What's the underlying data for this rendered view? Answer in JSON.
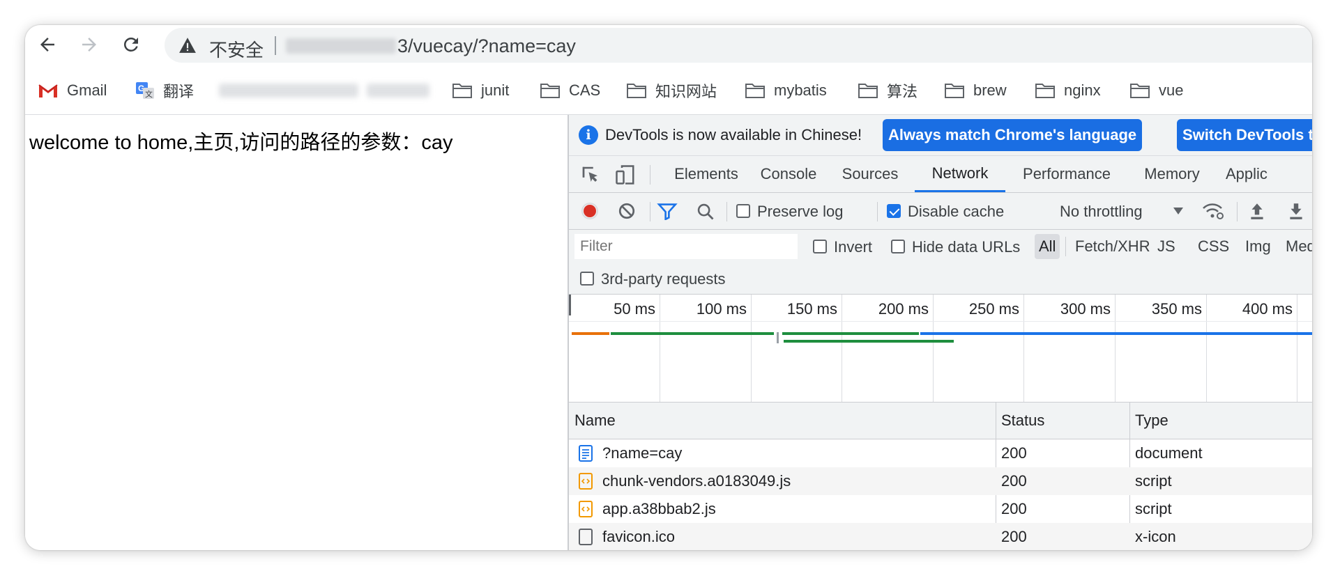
{
  "browser": {
    "security_label": "不安全",
    "url_suffix": "3/vuecay/?name=cay"
  },
  "bookmarks": [
    {
      "label": "Gmail",
      "icon": "gmail-icon"
    },
    {
      "label": "翻译",
      "icon": "translate-icon"
    },
    {
      "label": "junit",
      "icon": "folder-icon"
    },
    {
      "label": "CAS",
      "icon": "folder-icon"
    },
    {
      "label": "知识网站",
      "icon": "folder-icon"
    },
    {
      "label": "mybatis",
      "icon": "folder-icon"
    },
    {
      "label": "算法",
      "icon": "folder-icon"
    },
    {
      "label": "brew",
      "icon": "folder-icon"
    },
    {
      "label": "nginx",
      "icon": "folder-icon"
    },
    {
      "label": "vue",
      "icon": "folder-icon"
    }
  ],
  "page": {
    "text": "welcome to home,主页,访问的路径的参数：cay"
  },
  "devtools": {
    "infobar": {
      "message": "DevTools is now available in Chinese!",
      "button_match": "Always match Chrome's language",
      "button_switch": "Switch DevTools to C"
    },
    "tabs": [
      "Elements",
      "Console",
      "Sources",
      "Network",
      "Performance",
      "Memory",
      "Applic"
    ],
    "active_tab": "Network",
    "network_toolbar": {
      "preserve_log": "Preserve log",
      "disable_cache": "Disable cache",
      "throttling": "No throttling"
    },
    "filter": {
      "placeholder": "Filter",
      "invert": "Invert",
      "hide_data_urls": "Hide data URLs",
      "types": [
        "All",
        "Fetch/XHR",
        "JS",
        "CSS",
        "Img",
        "Med"
      ],
      "third_party": "3rd-party requests"
    },
    "timeline_ticks": [
      "50 ms",
      "100 ms",
      "150 ms",
      "200 ms",
      "250 ms",
      "300 ms",
      "350 ms",
      "400 ms"
    ],
    "table": {
      "headers": {
        "name": "Name",
        "status": "Status",
        "type": "Type"
      },
      "rows": [
        {
          "name": "?name=cay",
          "status": "200",
          "type": "document",
          "icon": "document-icon"
        },
        {
          "name": "chunk-vendors.a0183049.js",
          "status": "200",
          "type": "script",
          "icon": "script-file-icon"
        },
        {
          "name": "app.a38bbab2.js",
          "status": "200",
          "type": "script",
          "icon": "script-file-icon"
        },
        {
          "name": "favicon.ico",
          "status": "200",
          "type": "x-icon",
          "icon": "file-icon"
        }
      ]
    }
  },
  "colors": {
    "accent": "#1a73e8",
    "record": "#d93025",
    "waterfall_orange": "#e8710a",
    "waterfall_green": "#1e8e3e",
    "waterfall_blue": "#1a73e8"
  }
}
